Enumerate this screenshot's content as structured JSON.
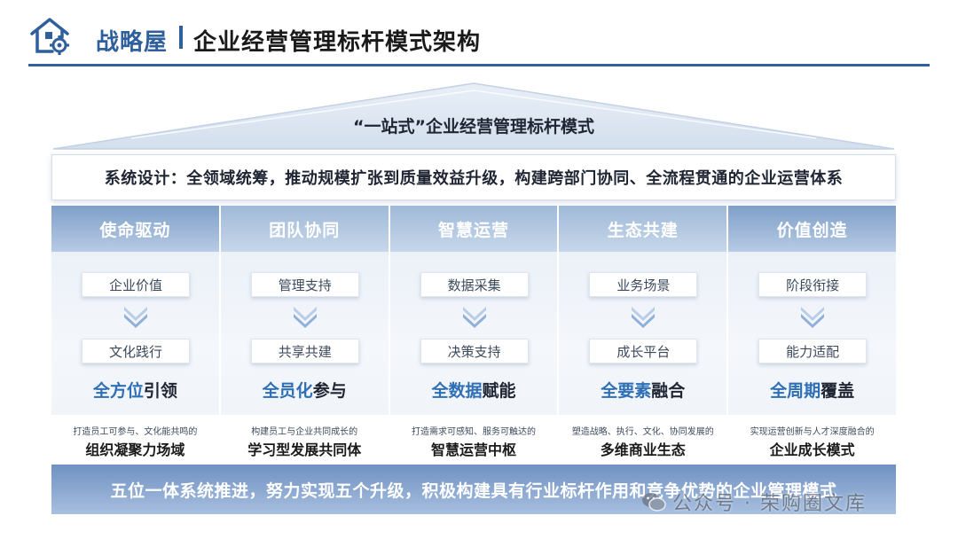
{
  "header": {
    "title_accent": "战略屋",
    "title_main": "企业经营管理标杆模式架构"
  },
  "roof": {
    "title": "“一站式”企业经营管理标杆模式"
  },
  "system": {
    "text": "系统设计：全领域统筹，推动规模扩张到质量效益升级，构建跨部门协同、全流程贯通的企业运营体系"
  },
  "pillars": [
    {
      "name": "使命驱动",
      "chip_top": "企业价值",
      "chip_bottom": "文化践行",
      "slogan_em": "全方位",
      "slogan_rest": "引领",
      "base_sub": "打造员工可参与、文化能共鸣的",
      "base_main": "组织凝聚力场域"
    },
    {
      "name": "团队协同",
      "chip_top": "管理支持",
      "chip_bottom": "共享共建",
      "slogan_em": "全员化",
      "slogan_rest": "参与",
      "base_sub": "构建员工与企业共同成长的",
      "base_main": "学习型发展共同体"
    },
    {
      "name": "智慧运营",
      "chip_top": "数据采集",
      "chip_bottom": "决策支持",
      "slogan_em": "全数据",
      "slogan_rest": "赋能",
      "base_sub": "打造需求可感知、服务可触达的",
      "base_main": "智慧运营中枢"
    },
    {
      "name": "生态共建",
      "chip_top": "业务场景",
      "chip_bottom": "成长平台",
      "slogan_em": "全要素",
      "slogan_rest": "融合",
      "base_sub": "塑造战略、执行、文化、协同发展的",
      "base_main": "多维商业生态"
    },
    {
      "name": "价值创造",
      "chip_top": "阶段衔接",
      "chip_bottom": "能力适配",
      "slogan_em": "全周期",
      "slogan_rest": "覆盖",
      "base_sub": "实现运营创新与人才深度融合的",
      "base_main": "企业成长模式"
    }
  ],
  "foundation": {
    "text": "五位一体系统推进，努力实现五个升级，积极构建具有行业标杆作用和竞争优势的企业管理模式"
  },
  "watermark": {
    "text": "公众号 · 荣购圈文库"
  },
  "colors": {
    "primary": "#2f5f9c",
    "accent": "#2f6fb5",
    "pillar_head": "#9fb9d8",
    "foundation": "#6f91c2"
  },
  "icons": {
    "logo": "house-gear-icon",
    "arrow": "double-chevron-down-icon",
    "watermark": "wechat-icon"
  }
}
